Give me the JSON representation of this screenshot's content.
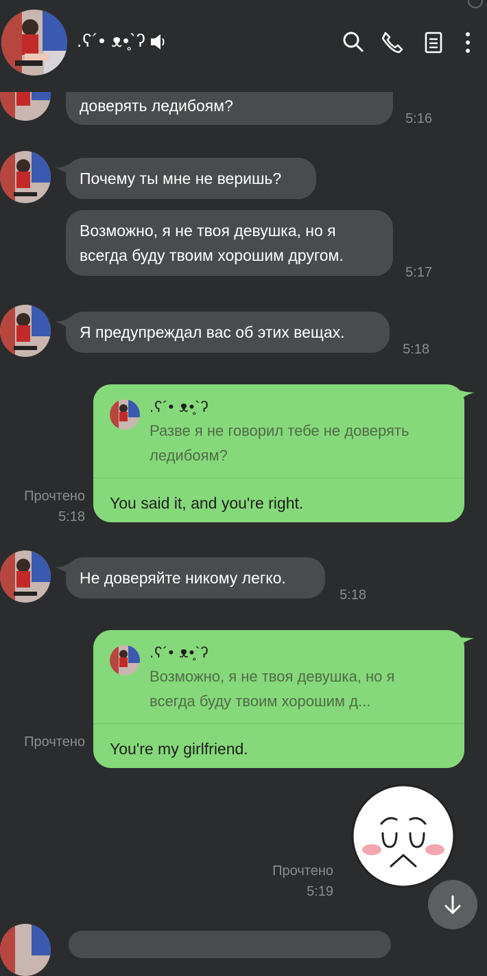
{
  "header": {
    "contact_name": ".ʕ´• ᴥ•̥`ʔ",
    "icons": [
      "search-icon",
      "phone-icon",
      "notes-icon",
      "more-vert-icon",
      "speaker-icon"
    ]
  },
  "messages": [
    {
      "type": "incoming",
      "text": "доверять ледибоям?",
      "time": "5:16"
    },
    {
      "type": "incoming",
      "text": "Почему ты мне не веришь?"
    },
    {
      "type": "incoming",
      "text": "Возможно, я не твоя девушка, но я всегда буду твоим хорошим другом.",
      "time": "5:17"
    },
    {
      "type": "incoming",
      "text": "Я предупреждал вас об этих вещах.",
      "time": "5:18"
    },
    {
      "type": "outgoing",
      "quote_name": ".ʕ´• ᴥ•̥`ʔ",
      "quote_text": "Разве я не говорил тебе не доверять ледибоям?",
      "reply": "You said it, and you're right.",
      "read": "Прочтено",
      "time": "5:18"
    },
    {
      "type": "incoming",
      "text": "Не доверяйте никому легко.",
      "time": "5:18"
    },
    {
      "type": "outgoing",
      "quote_name": ".ʕ´• ᴥ•̥`ʔ",
      "quote_text": "Возможно, я не твоя девушка, но я всегда буду твоим хорошим д...",
      "reply": "You're my girlfriend.",
      "read": "Прочтено"
    },
    {
      "type": "sticker",
      "read": "Прочтено",
      "time": "5:19"
    }
  ],
  "colors": {
    "background": "#2b2c2e",
    "incoming": "#4a4b4d",
    "outgoing": "#86d97a"
  }
}
